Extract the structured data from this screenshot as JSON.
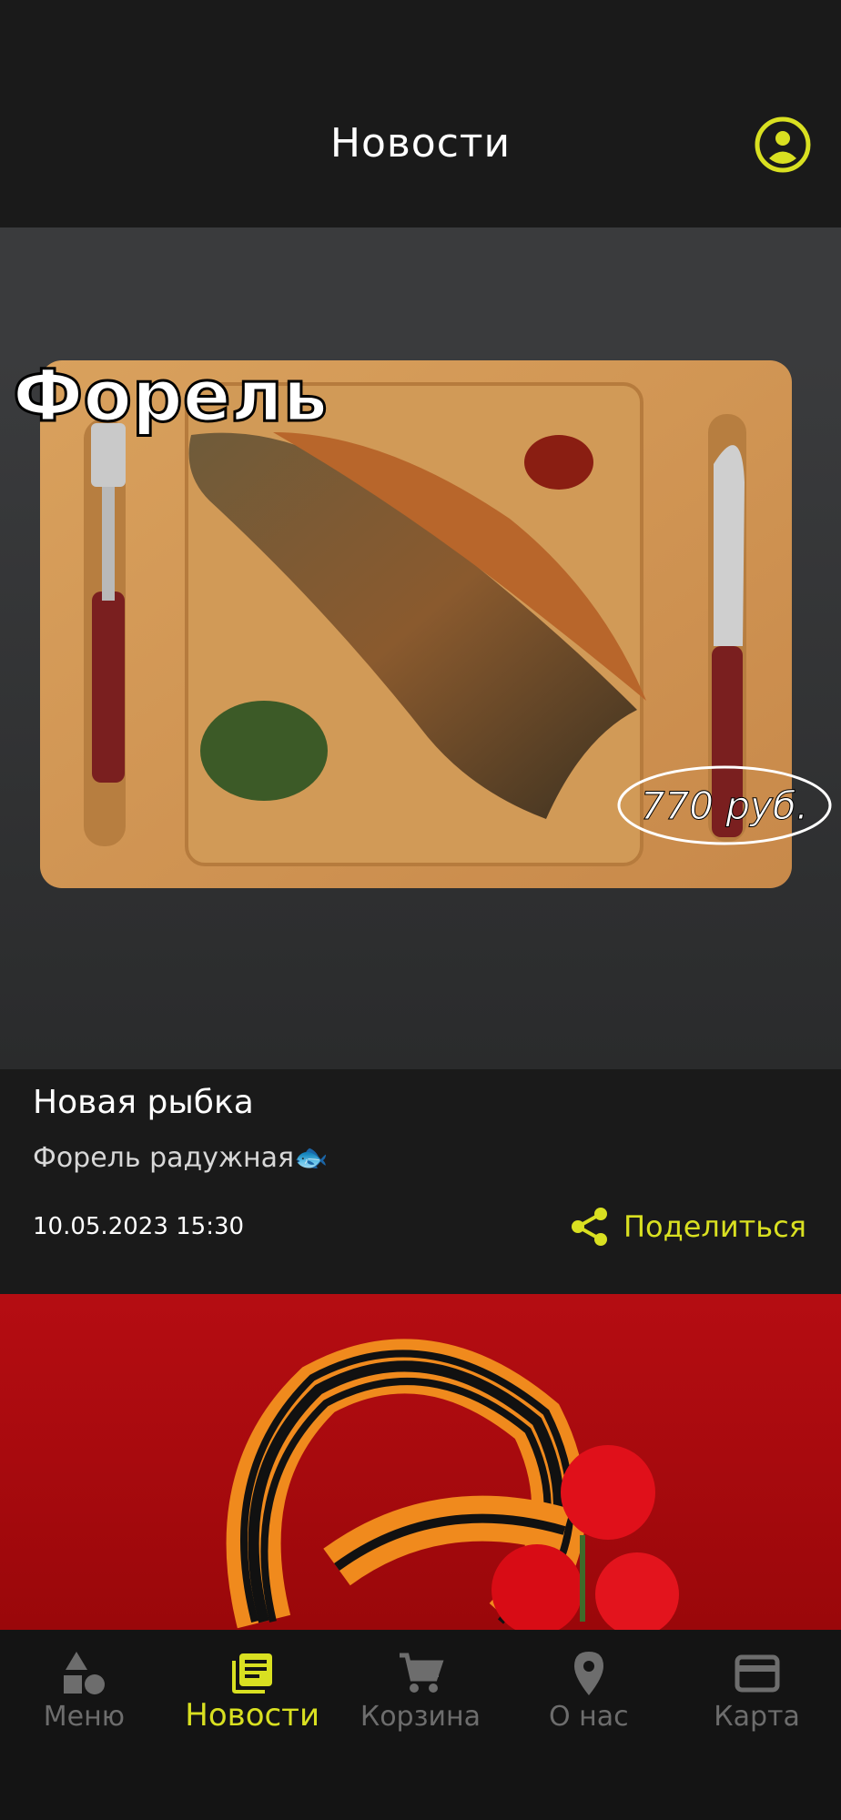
{
  "header": {
    "title": "Новости"
  },
  "news": [
    {
      "image_caption": "Форель",
      "image_price": "770 руб.",
      "title": "Новая рыбка",
      "description": "Форель радужная🐟",
      "date": "10.05.2023 15:30",
      "share_label": "Поделиться"
    }
  ],
  "nav": {
    "items": [
      {
        "label": "Меню",
        "icon": "shapes-icon",
        "active": false
      },
      {
        "label": "Новости",
        "icon": "news-icon",
        "active": true
      },
      {
        "label": "Корзина",
        "icon": "cart-icon",
        "active": false
      },
      {
        "label": "О нас",
        "icon": "location-pin-icon",
        "active": false
      },
      {
        "label": "Карта",
        "icon": "card-icon",
        "active": false
      }
    ]
  },
  "colors": {
    "accent": "#d9e021",
    "background": "#1a1a1a",
    "inactive": "#6d6d6d"
  }
}
